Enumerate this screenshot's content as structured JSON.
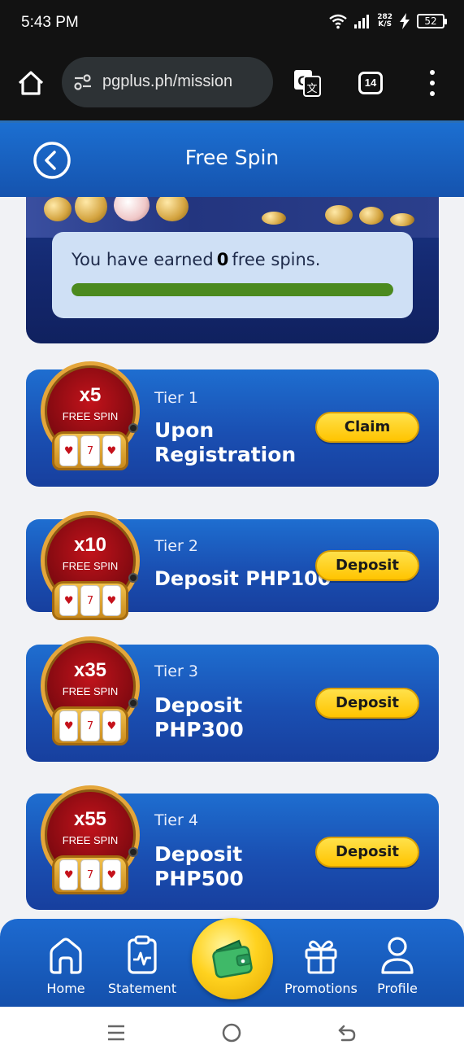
{
  "status": {
    "time": "5:43 PM",
    "speed_value": "282",
    "speed_unit": "K/S",
    "battery": "52"
  },
  "browser": {
    "url": "pgplus.ph/mission",
    "tab_count": "14"
  },
  "header": {
    "title": "Free Spin"
  },
  "progress": {
    "prefix": "You have earned",
    "count": "0",
    "suffix": "free spins.",
    "fraction": 1.0
  },
  "tiers": [
    {
      "multiplier": "x5",
      "badge_label": "FREE SPIN",
      "tier": "Tier 1",
      "title": "Upon Registration",
      "button": "Claim"
    },
    {
      "multiplier": "x10",
      "badge_label": "FREE SPIN",
      "tier": "Tier 2",
      "title": "Deposit PHP100",
      "button": "Deposit"
    },
    {
      "multiplier": "x35",
      "badge_label": "FREE SPIN",
      "tier": "Tier 3",
      "title": "Deposit PHP300",
      "button": "Deposit"
    },
    {
      "multiplier": "x55",
      "badge_label": "FREE SPIN",
      "tier": "Tier 4",
      "title": "Deposit PHP500",
      "button": "Deposit"
    }
  ],
  "bottom_nav": {
    "home": "Home",
    "statement": "Statement",
    "wallet_icon": "wallet-icon",
    "promotions": "Promotions",
    "profile": "Profile"
  },
  "colors": {
    "header_blue": "#1c6fd1",
    "button_yellow": "#ffc400",
    "progress_green": "#4b8a1e"
  }
}
